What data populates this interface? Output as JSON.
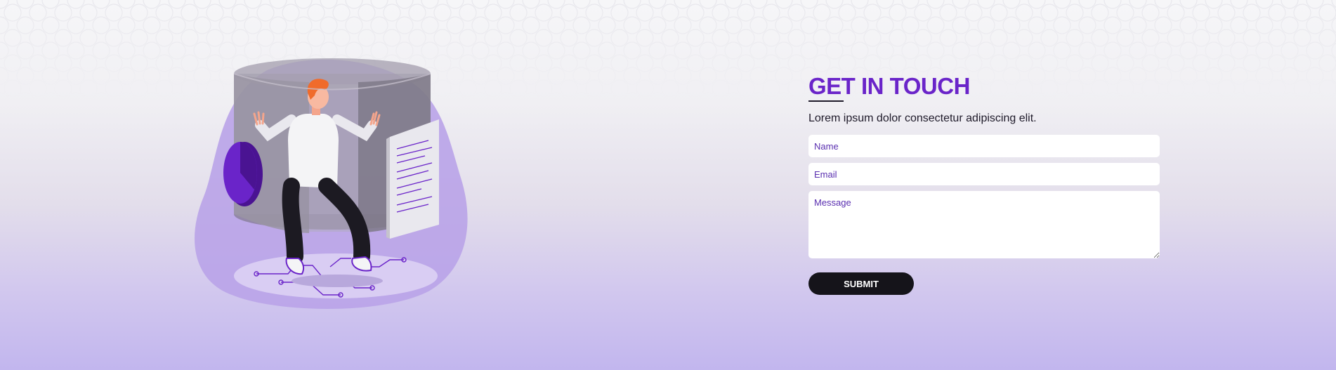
{
  "contact": {
    "title": "GET IN TOUCH",
    "subtitle": "Lorem ipsum dolor consectetur adipiscing elit.",
    "name_placeholder": "Name",
    "email_placeholder": "Email",
    "message_placeholder": "Message",
    "submit_label": "SUBMIT"
  },
  "colors": {
    "accent": "#6a24c9",
    "button": "#15141a",
    "background_bottom": "#c2b6ee"
  },
  "illustration": {
    "icon": "person-with-data-cylinder-illustration"
  }
}
